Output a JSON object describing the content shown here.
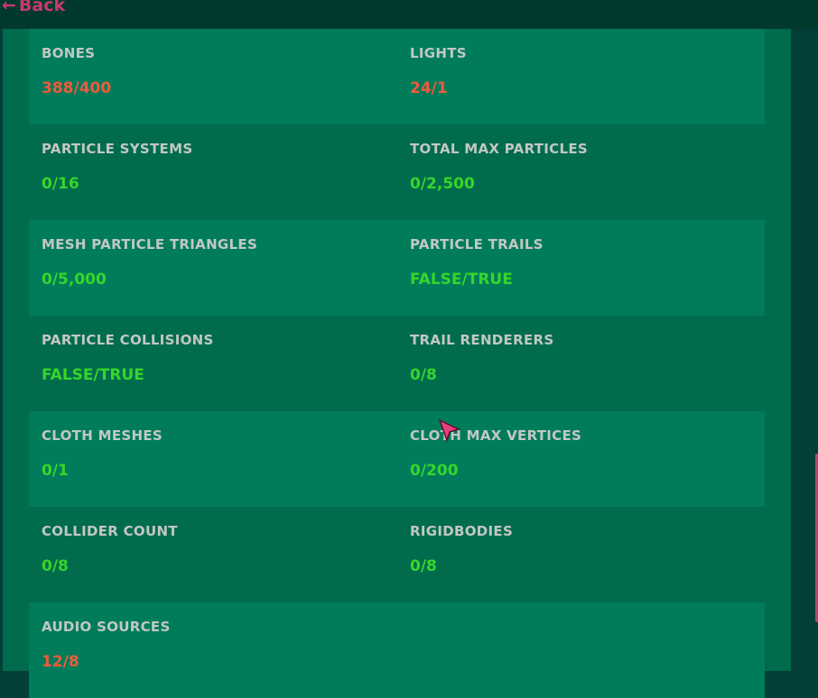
{
  "nav": {
    "back_label": "Back"
  },
  "colors": {
    "ok": "#36d62a",
    "over_limit": "#ef5a3c",
    "accent": "#c83a6c"
  },
  "stats": [
    {
      "label": "BONES",
      "value": "388/400",
      "status": "bad"
    },
    {
      "label": "LIGHTS",
      "value": "24/1",
      "status": "bad"
    },
    {
      "label": "PARTICLE SYSTEMS",
      "value": "0/16",
      "status": "ok"
    },
    {
      "label": "TOTAL MAX PARTICLES",
      "value": "0/2,500",
      "status": "ok"
    },
    {
      "label": "MESH PARTICLE TRIANGLES",
      "value": "0/5,000",
      "status": "ok"
    },
    {
      "label": "PARTICLE TRAILS",
      "value": "FALSE/TRUE",
      "status": "ok"
    },
    {
      "label": "PARTICLE COLLISIONS",
      "value": "FALSE/TRUE",
      "status": "ok"
    },
    {
      "label": "TRAIL RENDERERS",
      "value": "0/8",
      "status": "ok"
    },
    {
      "label": "CLOTH MESHES",
      "value": "0/1",
      "status": "ok"
    },
    {
      "label": "CLOTH MAX VERTICES",
      "value": "0/200",
      "status": "ok"
    },
    {
      "label": "COLLIDER COUNT",
      "value": "0/8",
      "status": "ok"
    },
    {
      "label": "RIGIDBODIES",
      "value": "0/8",
      "status": "ok"
    },
    {
      "label": "AUDIO SOURCES",
      "value": "12/8",
      "status": "bad"
    }
  ]
}
